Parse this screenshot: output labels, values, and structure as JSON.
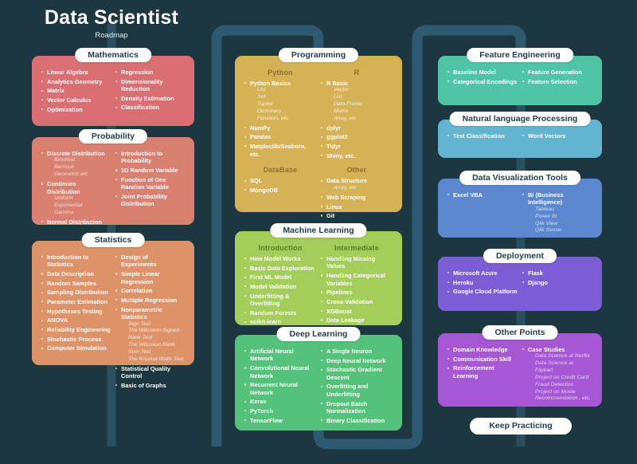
{
  "header": {
    "title": "Data Scientist",
    "subtitle": "Roadmap"
  },
  "colors": {
    "background": "#1d3741",
    "connector": "#2d5a6e",
    "pill_bg": "#ffffff",
    "pill_text": "#1f3d4a",
    "mathematics": "#d96f72",
    "probability": "#d98070",
    "statistics": "#dd9367",
    "programming": "#d6b256",
    "machine_learning": "#a5cd5a",
    "deep_learning": "#54c27a",
    "feature_engineering": "#4fc5a5",
    "nlp": "#63b4d1",
    "data_visualization": "#5b87cf",
    "deployment": "#7b5ed6",
    "other_points": "#a557d4"
  },
  "cards": {
    "mathematics": {
      "title": "Mathematics",
      "columns": [
        {
          "head": "",
          "items": [
            {
              "label": "Linear Algebra"
            },
            {
              "label": "Analytics Geometry"
            },
            {
              "label": "Matrix"
            },
            {
              "label": "Vector Calculus"
            },
            {
              "label": "Optimization"
            }
          ]
        },
        {
          "head": "",
          "items": [
            {
              "label": "Regression"
            },
            {
              "label": "Dimensionality Reduction"
            },
            {
              "label": "Density Estimation"
            },
            {
              "label": "Classification"
            }
          ]
        }
      ]
    },
    "probability": {
      "title": "Probability",
      "columns": [
        {
          "head": "",
          "items": [
            {
              "label": "Discrete Distribution",
              "sub": [
                "Binomial",
                "Bernouli",
                "Geometric etc"
              ]
            },
            {
              "label": "Continuos Distribution",
              "sub": [
                "Uniform",
                "Exponential",
                "Gamma"
              ]
            },
            {
              "label": "Normal Distribution"
            }
          ]
        },
        {
          "head": "",
          "items": [
            {
              "label": "Introduction to Probability"
            },
            {
              "label": "1D Random Variable"
            },
            {
              "label": "Function of One Random Variable"
            },
            {
              "label": "Joint Probability Distribution"
            }
          ]
        }
      ]
    },
    "statistics": {
      "title": "Statistics",
      "columns": [
        {
          "head": "",
          "items": [
            {
              "label": "Introduction to Statistics"
            },
            {
              "label": "Data Description"
            },
            {
              "label": "Random Samples"
            },
            {
              "label": "Sampling Distribution"
            },
            {
              "label": "Parameter Estimation"
            },
            {
              "label": "Hypotheses Testing"
            },
            {
              "label": "ANOVA"
            },
            {
              "label": "Reliability Engineering"
            },
            {
              "label": "Stochastic Process"
            },
            {
              "label": "Computer Simulation"
            }
          ]
        },
        {
          "head": "",
          "items": [
            {
              "label": "Design of Experiments"
            },
            {
              "label": "Simple Linear Regression"
            },
            {
              "label": "Correlation"
            },
            {
              "label": "Multiple Regression"
            },
            {
              "label": "Nonparametric Statistics",
              "sub": [
                "Sign Test",
                "The Wilcoxon Signed-Rank Test",
                "The Wilcoxon Rank Sum Test",
                "The Kruskal-Walls Test"
              ]
            },
            {
              "label": "Statistical Quality Control"
            },
            {
              "label": "Basic of Graphs"
            }
          ]
        }
      ]
    },
    "programming": {
      "title": "Programming",
      "columns": [
        {
          "head": "Python",
          "items": [
            {
              "label": "Python Basics",
              "sub": [
                "List",
                "Set",
                "Tuples",
                "Dictionary",
                "Function, etc"
              ]
            },
            {
              "label": "NumPy"
            },
            {
              "label": "Pandas"
            },
            {
              "label": "Matploclib/Seaborn, etc."
            }
          ]
        },
        {
          "head": "R",
          "items": [
            {
              "label": "R Basic",
              "sub": [
                "Vector",
                "List",
                "Data Frame",
                "Matrix",
                "Array, etc"
              ]
            },
            {
              "label": "dplyr"
            },
            {
              "label": "ggplot2"
            },
            {
              "label": "Tidyr"
            },
            {
              "label": "Shiny, etc."
            }
          ]
        }
      ],
      "columns2": [
        {
          "head": "DataBase",
          "items": [
            {
              "label": "SQL"
            },
            {
              "label": "MongoDB"
            }
          ]
        },
        {
          "head": "Other",
          "items": [
            {
              "label": "Data Structure",
              "sub": [
                "Array, etc"
              ]
            },
            {
              "label": "Web Scraping"
            },
            {
              "label": "Linux"
            },
            {
              "label": "Git"
            }
          ]
        }
      ]
    },
    "machine_learning": {
      "title": "Machine Learning",
      "columns": [
        {
          "head": "Introduction",
          "items": [
            {
              "label": "How Model Works"
            },
            {
              "label": "Basic Data Exploration"
            },
            {
              "label": "First ML Model"
            },
            {
              "label": "Model Validation"
            },
            {
              "label": "Underfitting & Overfitting"
            },
            {
              "label": "Random Forests"
            },
            {
              "label": "scikit-learn"
            }
          ]
        },
        {
          "head": "Intermediate",
          "items": [
            {
              "label": "Handling Missing Values"
            },
            {
              "label": "Handling Categorical Variables"
            },
            {
              "label": "Pipelines"
            },
            {
              "label": "Cross-Validation"
            },
            {
              "label": "XGBoost"
            },
            {
              "label": "Data Leakage"
            }
          ]
        }
      ]
    },
    "deep_learning": {
      "title": "Deep Learning",
      "columns": [
        {
          "head": "",
          "items": [
            {
              "label": "Artificial Neural Network"
            },
            {
              "label": "Convolutional Neural Network"
            },
            {
              "label": "Recurrent Neural Network"
            },
            {
              "label": "Keras"
            },
            {
              "label": "PyTorch"
            },
            {
              "label": "TensorFlow"
            }
          ]
        },
        {
          "head": "",
          "items": [
            {
              "label": "A Single Neuron"
            },
            {
              "label": "Deep Neural Network"
            },
            {
              "label": "Stochastic Gradient Descent"
            },
            {
              "label": "Overfitting and Underfitting"
            },
            {
              "label": "Dropout Batch Normalization"
            },
            {
              "label": "Binary Classification"
            }
          ]
        }
      ]
    },
    "feature_engineering": {
      "title": "Feature Engineering",
      "columns": [
        {
          "head": "",
          "items": [
            {
              "label": "Baseline Model"
            },
            {
              "label": "Categorical Encodings"
            }
          ]
        },
        {
          "head": "",
          "items": [
            {
              "label": "Feature Generation"
            },
            {
              "label": "Feature Selection"
            }
          ]
        }
      ]
    },
    "nlp": {
      "title": "Natural language Processing",
      "columns": [
        {
          "head": "",
          "items": [
            {
              "label": "Text Classification"
            }
          ]
        },
        {
          "head": "",
          "items": [
            {
              "label": "Word Vectors"
            }
          ]
        }
      ]
    },
    "data_visualization": {
      "title": "Data Visualization Tools",
      "columns": [
        {
          "head": "",
          "items": [
            {
              "label": "Excel VBA"
            }
          ]
        },
        {
          "head": "",
          "items": [
            {
              "label": "BI (Business Intelligence)",
              "sub": [
                "Tableau",
                "Power BI",
                "Qlik View",
                "Qlik Sense"
              ]
            }
          ]
        }
      ]
    },
    "deployment": {
      "title": "Deployment",
      "columns": [
        {
          "head": "",
          "items": [
            {
              "label": "Microsoft Azure"
            },
            {
              "label": "Heroku"
            },
            {
              "label": "Google Cloud Platform"
            }
          ]
        },
        {
          "head": "",
          "items": [
            {
              "label": "Flask"
            },
            {
              "label": "Django"
            }
          ]
        }
      ]
    },
    "other_points": {
      "title": "Other Points",
      "columns": [
        {
          "head": "",
          "items": [
            {
              "label": "Domain Knowledge"
            },
            {
              "label": "Communication Skill"
            },
            {
              "label": "Reinforcement Learning"
            }
          ]
        },
        {
          "head": "",
          "items": [
            {
              "label": "Case Studies",
              "sub": [
                "Data Science at Netflix",
                "Data Science at Flipkart",
                "Project on Credit Card Fraud Detection",
                "Project on Movie Recommendation , etc."
              ]
            }
          ]
        }
      ]
    }
  },
  "keep_practicing": {
    "label": "Keep Practicing"
  }
}
